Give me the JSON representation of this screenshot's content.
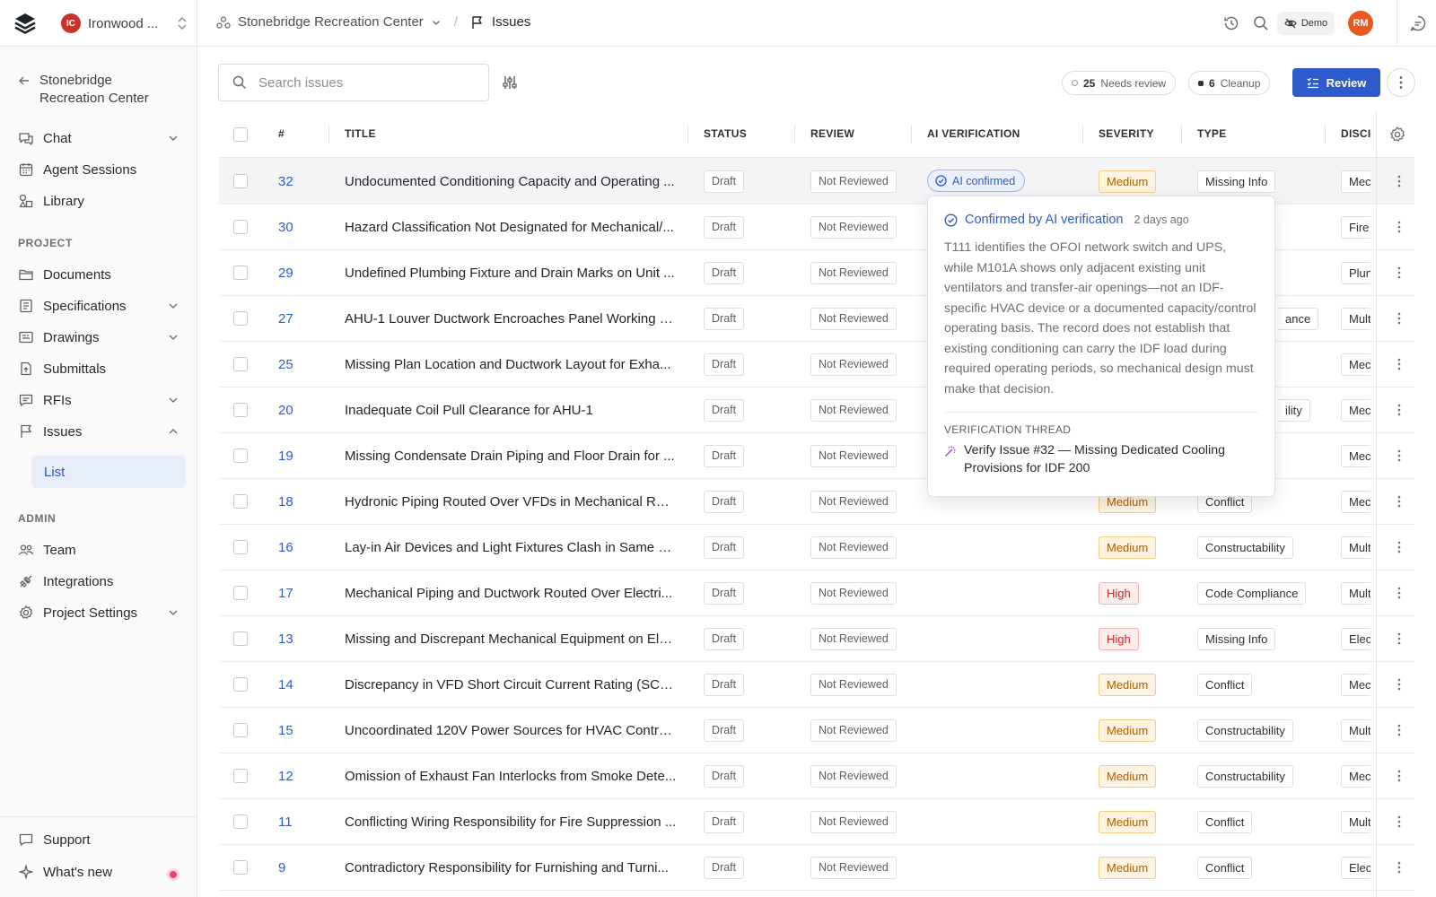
{
  "header": {
    "org_initials": "IC",
    "org_name": "Ironwood ...",
    "project": "Stonebridge Recreation Center",
    "current_page": "Issues",
    "demo_label": "Demo",
    "user_initials": "RM"
  },
  "sidebar": {
    "back_label": "Stonebridge Recreation Center",
    "top_items": [
      {
        "label": "Chat"
      },
      {
        "label": "Agent Sessions"
      },
      {
        "label": "Library"
      }
    ],
    "project_label": "PROJECT",
    "project_items": [
      {
        "label": "Documents"
      },
      {
        "label": "Specifications"
      },
      {
        "label": "Drawings"
      },
      {
        "label": "Submittals"
      },
      {
        "label": "RFIs"
      },
      {
        "label": "Issues"
      },
      {
        "label": "List"
      }
    ],
    "admin_label": "ADMIN",
    "admin_items": [
      {
        "label": "Team"
      },
      {
        "label": "Integrations"
      },
      {
        "label": "Project Settings"
      }
    ],
    "bottom_items": [
      {
        "label": "Support"
      },
      {
        "label": "What's new"
      }
    ]
  },
  "toolbar": {
    "search_placeholder": "Search issues",
    "needs_review_count": "25",
    "needs_review_label": "Needs review",
    "cleanup_count": "6",
    "cleanup_label": "Cleanup",
    "review_label": "Review"
  },
  "table": {
    "columns": [
      "#",
      "TITLE",
      "STATUS",
      "REVIEW",
      "AI VERIFICATION",
      "SEVERITY",
      "TYPE",
      "DISCI"
    ],
    "rows": [
      {
        "num": "32",
        "title": "Undocumented Conditioning Capacity and Operating ...",
        "status": "Draft",
        "review": "Not Reviewed",
        "ai": "AI confirmed",
        "severity": "Medium",
        "type": "Missing Info",
        "disc": "Mec"
      },
      {
        "num": "30",
        "title": "Hazard Classification Not Designated for Mechanical/...",
        "status": "Draft",
        "review": "Not Reviewed",
        "ai": "",
        "severity": "",
        "type": "",
        "disc": "Fire"
      },
      {
        "num": "29",
        "title": "Undefined Plumbing Fixture and Drain Marks on Unit ...",
        "status": "Draft",
        "review": "Not Reviewed",
        "ai": "",
        "severity": "",
        "type": "",
        "disc": "Plun"
      },
      {
        "num": "27",
        "title": "AHU-1 Louver Ductwork Encroaches Panel Working S...",
        "status": "Draft",
        "review": "Not Reviewed",
        "ai": "",
        "severity": "",
        "type": "ance",
        "disc": "Mult"
      },
      {
        "num": "25",
        "title": "Missing Plan Location and Ductwork Layout for Exha...",
        "status": "Draft",
        "review": "Not Reviewed",
        "ai": "",
        "severity": "",
        "type": "",
        "disc": "Mec"
      },
      {
        "num": "20",
        "title": "Inadequate Coil Pull Clearance for AHU-1",
        "status": "Draft",
        "review": "Not Reviewed",
        "ai": "",
        "severity": "",
        "type": "ility",
        "disc": "Mec"
      },
      {
        "num": "19",
        "title": "Missing Condensate Drain Piping and Floor Drain for ...",
        "status": "Draft",
        "review": "Not Reviewed",
        "ai": "",
        "severity": "",
        "type": "",
        "disc": "Mec"
      },
      {
        "num": "18",
        "title": "Hydronic Piping Routed Over VFDs in Mechanical Room",
        "status": "Draft",
        "review": "Not Reviewed",
        "ai": "",
        "severity": "Medium",
        "type": "Conflict",
        "disc": "Mec"
      },
      {
        "num": "16",
        "title": "Lay-in Air Devices and Light Fixtures Clash in Same C...",
        "status": "Draft",
        "review": "Not Reviewed",
        "ai": "",
        "severity": "Medium",
        "type": "Constructability",
        "disc": "Mult"
      },
      {
        "num": "17",
        "title": "Mechanical Piping and Ductwork Routed Over Electri...",
        "status": "Draft",
        "review": "Not Reviewed",
        "ai": "",
        "severity": "High",
        "type": "Code Compliance",
        "disc": "Mult"
      },
      {
        "num": "13",
        "title": "Missing and Discrepant Mechanical Equipment on Ele...",
        "status": "Draft",
        "review": "Not Reviewed",
        "ai": "",
        "severity": "High",
        "type": "Missing Info",
        "disc": "Elec"
      },
      {
        "num": "14",
        "title": "Discrepancy in VFD Short Circuit Current Rating (SCC...",
        "status": "Draft",
        "review": "Not Reviewed",
        "ai": "",
        "severity": "Medium",
        "type": "Conflict",
        "disc": "Mec"
      },
      {
        "num": "15",
        "title": "Uncoordinated 120V Power Sources for HVAC Control...",
        "status": "Draft",
        "review": "Not Reviewed",
        "ai": "",
        "severity": "Medium",
        "type": "Constructability",
        "disc": "Mult"
      },
      {
        "num": "12",
        "title": "Omission of Exhaust Fan Interlocks from Smoke Dete...",
        "status": "Draft",
        "review": "Not Reviewed",
        "ai": "",
        "severity": "Medium",
        "type": "Constructability",
        "disc": "Mec"
      },
      {
        "num": "11",
        "title": "Conflicting Wiring Responsibility for Fire Suppression ...",
        "status": "Draft",
        "review": "Not Reviewed",
        "ai": "",
        "severity": "Medium",
        "type": "Conflict",
        "disc": "Mult"
      },
      {
        "num": "9",
        "title": "Contradictory Responsibility for Furnishing and Turni...",
        "status": "Draft",
        "review": "Not Reviewed",
        "ai": "",
        "severity": "Medium",
        "type": "Conflict",
        "disc": "Elec"
      }
    ]
  },
  "popover": {
    "title": "Confirmed by AI verification",
    "time": "2 days ago",
    "body": "T111 identifies the OFOI network switch and UPS, while M101A shows only adjacent existing unit ventilators and transfer-air openings—not an IDF-specific HVAC device or a documented capacity/control operating basis. The record does not establish that existing conditioning can carry the IDF load during required operating periods, so mechanical design must make that decision.",
    "thread_label": "VERIFICATION THREAD",
    "thread_title": "Verify Issue #32 — Missing Dedicated Cooling Provisions for IDF 200"
  },
  "colors": {
    "accent": "#2e5bcc",
    "medium_bg": "#fdf3e0",
    "medium_text": "#b35c00",
    "high_bg": "#fdecec",
    "high_text": "#c4262b"
  }
}
